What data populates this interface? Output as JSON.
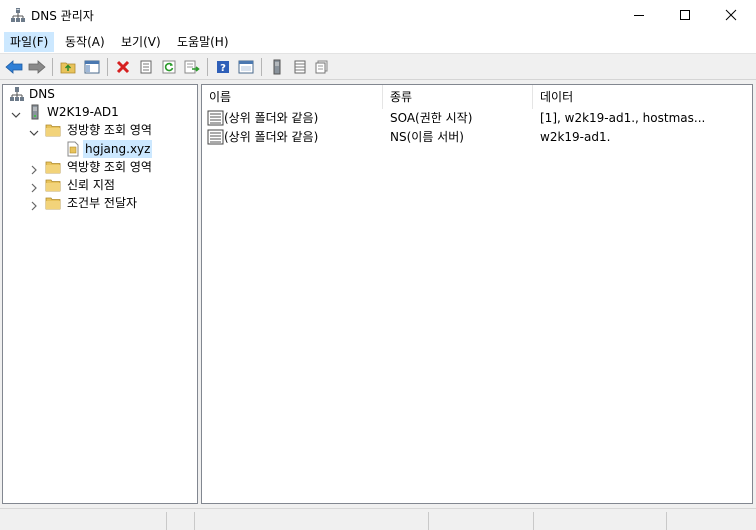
{
  "window": {
    "title": "DNS 관리자",
    "app_icon": "dns-server-icon"
  },
  "menubar": {
    "items": [
      {
        "label": "파일(F)"
      },
      {
        "label": "동작(A)"
      },
      {
        "label": "보기(V)"
      },
      {
        "label": "도움말(H)"
      }
    ]
  },
  "toolbar": {
    "buttons": [
      "back-icon",
      "forward-icon",
      "up-folder-icon",
      "show-hide-tree-icon",
      "delete-icon",
      "properties-icon",
      "refresh-icon",
      "export-list-icon",
      "help-icon",
      "show-console-icon",
      "server-icon",
      "zone-list-icon",
      "record-icon"
    ]
  },
  "tree": {
    "root": "DNS",
    "server": "W2K19-AD1",
    "forward_zones": "정방향 조회 영역",
    "zone": "hgjang.xyz",
    "reverse_zones": "역방향 조회 영역",
    "trust_points": "신뢰 지점",
    "conditional_forwarders": "조건부 전달자"
  },
  "list": {
    "columns": [
      "이름",
      "종류",
      "데이터"
    ],
    "rows": [
      {
        "name": "(상위 폴더와 같음)",
        "type": "SOA(권한 시작)",
        "data": "[1], w2k19-ad1., hostmas..."
      },
      {
        "name": "(상위 폴더와 같음)",
        "type": "NS(이름 서버)",
        "data": "w2k19-ad1."
      }
    ]
  },
  "colors": {
    "selection": "#cce8ff",
    "accent_blue": "#1e6fd0",
    "folder": "#e8c35b"
  }
}
